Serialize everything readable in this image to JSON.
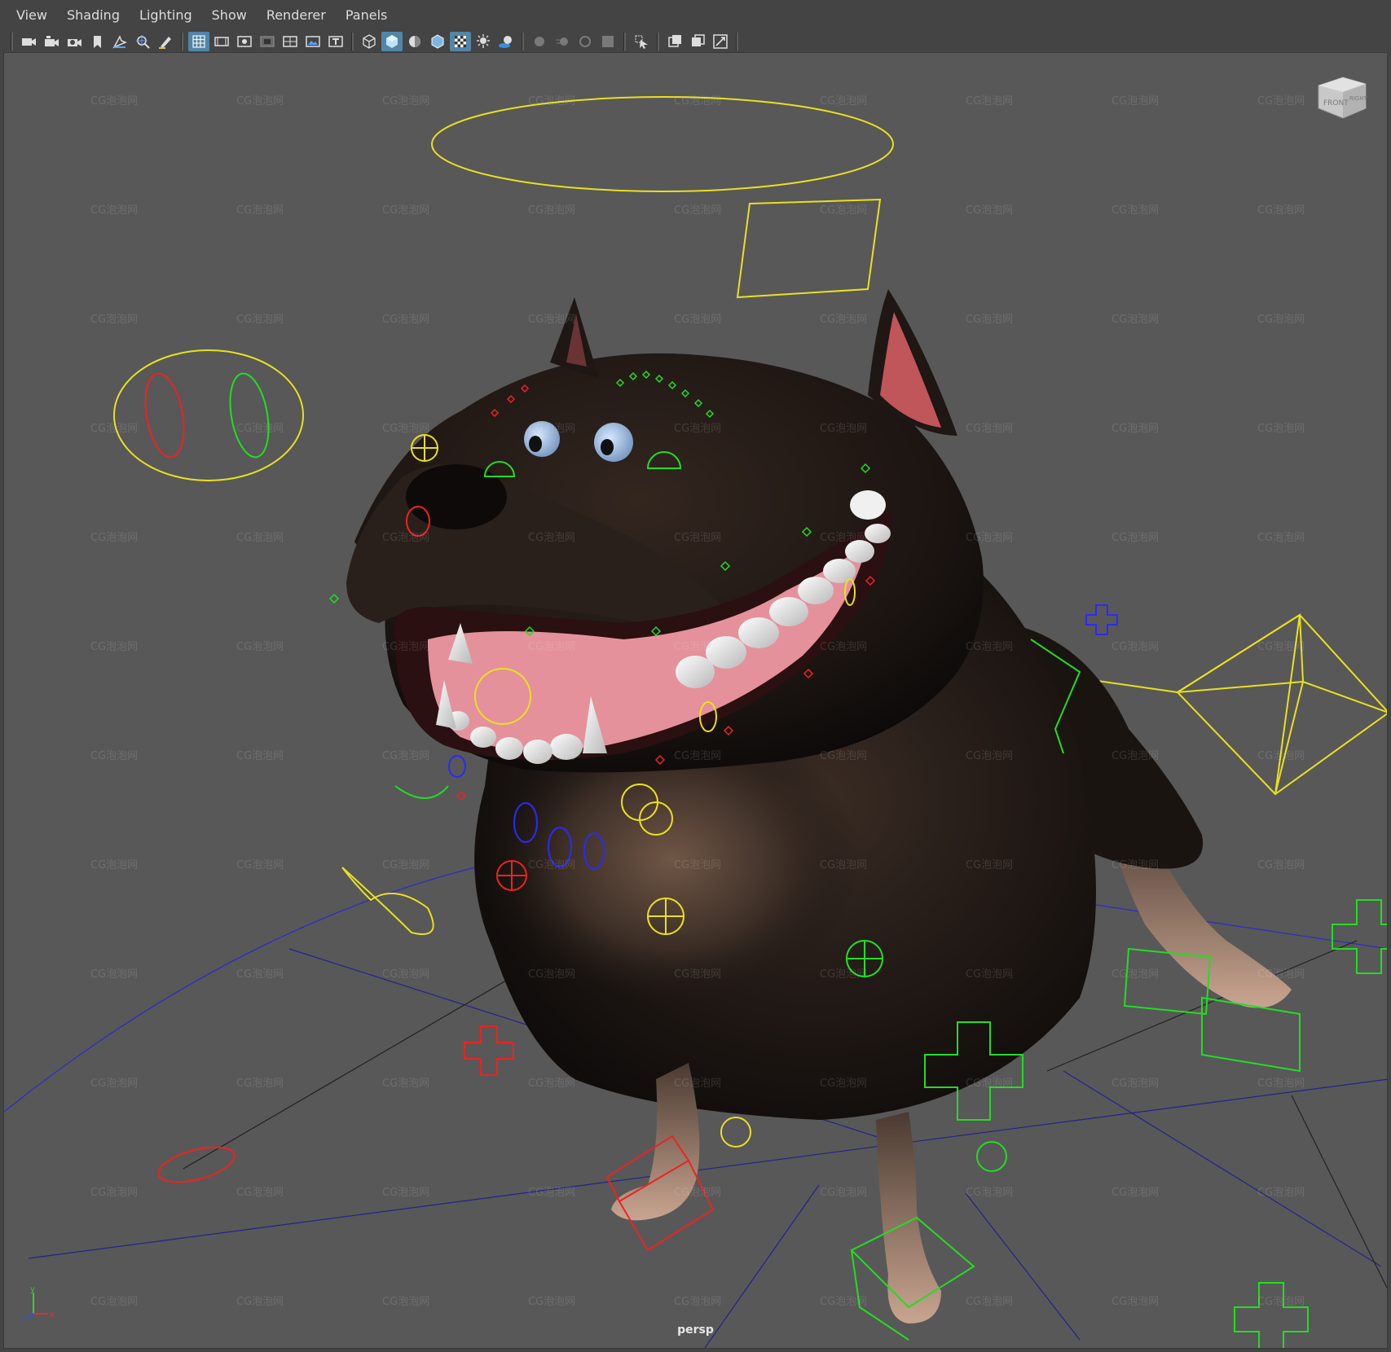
{
  "menu": {
    "items": [
      {
        "id": "view",
        "label": "View"
      },
      {
        "id": "shading",
        "label": "Shading"
      },
      {
        "id": "lighting",
        "label": "Lighting"
      },
      {
        "id": "show",
        "label": "Show"
      },
      {
        "id": "renderer",
        "label": "Renderer"
      },
      {
        "id": "panels",
        "label": "Panels"
      }
    ]
  },
  "toolbar": {
    "groups": [
      [
        {
          "name": "select-camera-icon",
          "active": false
        },
        {
          "name": "camera-attributes-icon",
          "active": false
        },
        {
          "name": "camera-settings-icon",
          "active": false
        },
        {
          "name": "bookmark-icon",
          "active": false
        },
        {
          "name": "image-plane-icon",
          "active": false
        },
        {
          "name": "2d-pan-zoom-icon",
          "active": false
        },
        {
          "name": "grease-pencil-icon",
          "active": false
        }
      ],
      [
        {
          "name": "grid-icon",
          "active": true
        },
        {
          "name": "film-gate-icon",
          "active": false
        },
        {
          "name": "resolution-gate-icon",
          "active": false
        },
        {
          "name": "gate-mask-icon",
          "active": false
        },
        {
          "name": "field-chart-icon",
          "active": false
        },
        {
          "name": "safe-action-icon",
          "active": false
        },
        {
          "name": "safe-title-icon",
          "active": false
        }
      ],
      [
        {
          "name": "wireframe-icon",
          "active": false
        },
        {
          "name": "smooth-shade-icon",
          "active": true
        },
        {
          "name": "use-default-material-icon",
          "active": false
        },
        {
          "name": "wireframe-on-shaded-icon",
          "active": false
        },
        {
          "name": "textured-icon",
          "active": true
        },
        {
          "name": "use-all-lights-icon",
          "active": false
        },
        {
          "name": "shadows-icon",
          "active": false
        }
      ],
      [
        {
          "name": "screen-space-ao-icon",
          "active": false,
          "dim": true
        },
        {
          "name": "motion-blur-icon",
          "active": false,
          "dim": true
        },
        {
          "name": "multisample-aa-icon",
          "active": false,
          "dim": true
        },
        {
          "name": "depth-of-field-icon",
          "active": false,
          "dim": true
        }
      ],
      [
        {
          "name": "isolate-select-icon",
          "active": false
        }
      ],
      [
        {
          "name": "xray-icon",
          "active": false
        },
        {
          "name": "xray-joints-icon",
          "active": false
        },
        {
          "name": "xray-active-components-icon",
          "active": false
        }
      ]
    ]
  },
  "viewport": {
    "camera_label": "persp",
    "watermark_text": "CG泡泡网",
    "viewcube": {
      "front": "FRONT",
      "side": "RIGHT"
    },
    "axis": {
      "y": "y",
      "z": "z",
      "x": "x"
    }
  },
  "colors": {
    "background": "#585858",
    "ui_bg": "#444444",
    "accent": "#5285a6",
    "control_yellow": "#ffff33",
    "control_green": "#22ff22",
    "control_red": "#ff2222",
    "control_blue": "#2a2aff",
    "fur_dark": "#1e1714"
  }
}
